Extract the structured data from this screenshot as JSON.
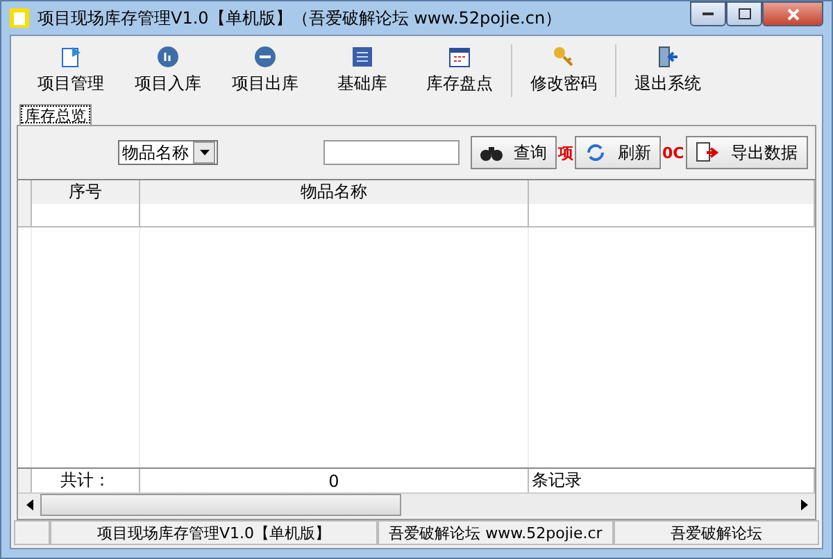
{
  "window": {
    "title": "项目现场库存管理V1.0【单机版】（吾爱破解论坛 www.52pojie.cn）"
  },
  "toolbar": [
    {
      "label": "项目管理",
      "kind": "doc"
    },
    {
      "label": "项目入库",
      "kind": "in"
    },
    {
      "label": "项目出库",
      "kind": "out"
    },
    {
      "label": "基础库",
      "kind": "list"
    },
    {
      "label": "库存盘点",
      "kind": "calendar"
    },
    {
      "label": "修改密码",
      "kind": "key"
    },
    {
      "label": "退出系统",
      "kind": "exit"
    }
  ],
  "tabs": [
    {
      "label": "库存总览",
      "selected": true
    }
  ],
  "filter": {
    "field_select": "物品名称",
    "buttons": [
      {
        "label": "查询",
        "kind": "search",
        "trail": "项"
      },
      {
        "label": "刷新",
        "kind": "refresh",
        "trail": "0C"
      },
      {
        "label": "导出数据",
        "kind": "export"
      }
    ]
  },
  "table": {
    "columns": [
      "序号",
      "物品名称"
    ],
    "footer": {
      "label": "共计：",
      "count": "0",
      "unit": "条记录"
    }
  },
  "status_bar": [
    "项目现场库存管理V1.0【单机版】",
    "吾爱破解论坛 www.52pojie.cr",
    "吾爱破解论坛"
  ]
}
